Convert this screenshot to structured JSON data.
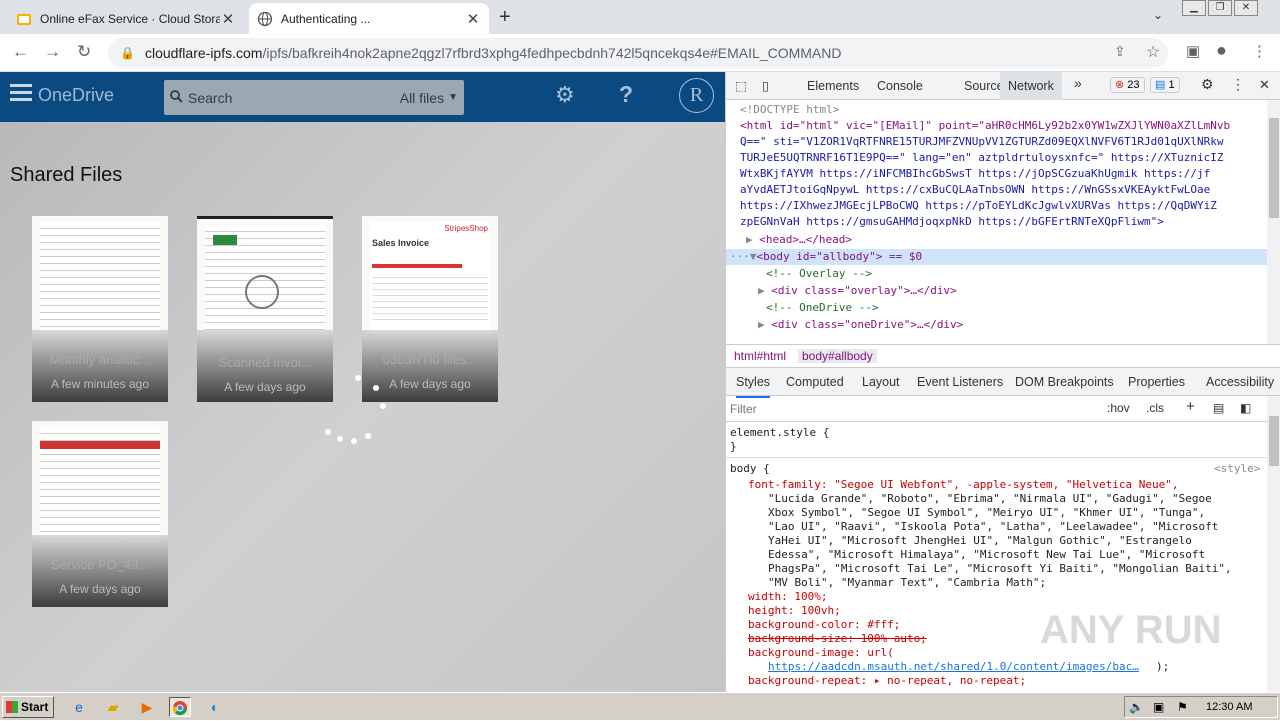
{
  "browser": {
    "tabs": [
      {
        "title": "Online eFax Service · Cloud Storage",
        "favicon": "folder-icon"
      },
      {
        "title": "Authenticating ...",
        "favicon": "globe-icon"
      }
    ],
    "url_host": "cloudflare-ipfs.com",
    "url_path": "/ipfs/bafkreih4nok2apne2qgzl7rfbrd3xphg4fedhpecbdnh742l5qncekqs4e#EMAIL_COMMAND"
  },
  "onedrive": {
    "brand": "OneDrive",
    "search_placeholder": "Search",
    "search_scope": "All files",
    "avatar_letter": "R",
    "section_title": "Shared Files",
    "files": [
      {
        "name": "Monthly analitic...",
        "date": "A few minutes ago"
      },
      {
        "name": "Scanned Invoi...",
        "date": "A few days ago"
      },
      {
        "name": "0363NTI0 files...",
        "date": "A few days ago"
      },
      {
        "name": "Service PO_49...",
        "date": "A few days ago"
      }
    ],
    "sales_doc_title": "Sales Invoice",
    "sales_doc_brand": "StripesShop"
  },
  "devtools": {
    "tabs": [
      "Elements",
      "Console",
      "Sources",
      "Network"
    ],
    "active_tab": "Network",
    "more": "»",
    "error_count": "23",
    "message_count": "1",
    "html_lines": [
      "<!DOCTYPE html>",
      "<html id=\"html\" vic=\"[EMail]\" point=\"aHR0cHM6Ly92b2x0YW1wZXJlYWN0aXZlLmNvb",
      "Q==\" sti=\"V1ZOR1VqRTFNRE15TURJMFZVNUpVV1ZGTURZd09EQXlNVFV6T1RJd01qUXlNRkw",
      "TURJeE5UQTRNRF16T1E9PQ==\" lang=\"en\" aztpldrtuloysxnfc=\" https://XTuznicIZ",
      "WtxBKjfAYVM  https://iNFCMBIhcGbSwsT  https://jOpSCGzuaKhUgmik  https://jf",
      "aYvdAETJtoiGqNpywL  https://cxBuCQLAaTnbsOWN  https://WnGSsxVKEAyktFwLOae",
      "https://IXhwezJMGEcjLPBoCWQ  https://pToEYLdKcJgwlvXURVas  https://QqDWYiZ",
      "zpEGNnVaH  https://gmsuGAHMdjoqxpNkD  https://bGFErtRNTeXQpFliwm\">",
      "<head>…</head>",
      "<body id=\"allbody\"> == $0",
      "<!-- Overlay -->",
      "<div class=\"overlay\">…</div>",
      "<!-- OneDrive -->",
      "<div class=\"oneDrive\">…</div>"
    ],
    "breadcrumbs": [
      "html#html",
      "body#allbody"
    ],
    "styles_tabs": [
      "Styles",
      "Computed",
      "Layout",
      "Event Listeners",
      "DOM Breakpoints",
      "Properties",
      "Accessibility"
    ],
    "filter_placeholder": "Filter",
    "filter_hov": ":hov",
    "filter_cls": ".cls",
    "css_lines": [
      "element.style {",
      "}",
      "body {",
      "<style>",
      "font-family: \"Segoe UI Webfont\", -apple-system, \"Helvetica Neue\",",
      "\"Lucida Grande\", \"Roboto\", \"Ebrima\", \"Nirmala UI\", \"Gadugi\", \"Segoe",
      "Xbox Symbol\", \"Segoe UI Symbol\", \"Meiryo UI\", \"Khmer UI\", \"Tunga\",",
      "\"Lao UI\", \"Raavi\", \"Iskoola Pota\", \"Latha\", \"Leelawadee\", \"Microsoft",
      "YaHei UI\", \"Microsoft JhengHei UI\", \"Malgun Gothic\", \"Estrangelo",
      "Edessa\", \"Microsoft Himalaya\", \"Microsoft New Tai Lue\", \"Microsoft",
      "PhagsPa\", \"Microsoft Tai Le\", \"Microsoft Yi Baiti\", \"Mongolian Baiti\",",
      "\"MV Boli\", \"Myanmar Text\", \"Cambria Math\";",
      "width: 100%;",
      "height: 100vh;",
      "background-color: #fff;",
      "background-size: 100% auto;",
      "background-image: url(",
      "https://aadcdn.msauth.net/shared/1.0/content/images/bac…",
      ");",
      "background-repeat: ▸ no-repeat, no-repeat;"
    ]
  },
  "taskbar": {
    "start_label": "Start",
    "clock": "12:30 AM"
  },
  "watermark": "ANY RUN",
  "colors": {
    "onedrive_header": "#0a4a80",
    "devtools_accent": "#1a73e8"
  }
}
